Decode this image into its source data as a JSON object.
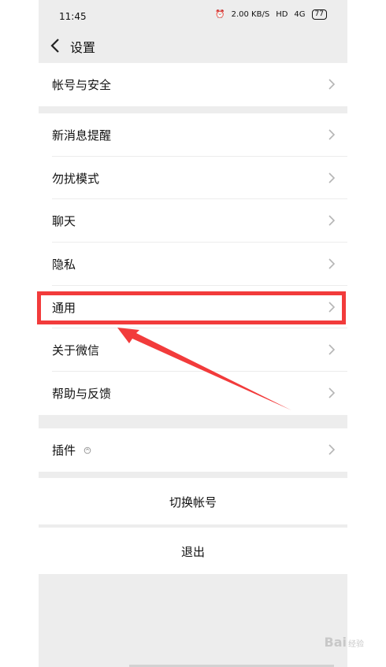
{
  "status_bar": {
    "time": "11:45",
    "speed": "2.00 KB/S",
    "network_1": "HD",
    "network_2": "4G",
    "battery": "77"
  },
  "header": {
    "title": "设置"
  },
  "groups": {
    "account": [
      {
        "label": "帐号与安全"
      }
    ],
    "main": [
      {
        "label": "新消息提醒"
      },
      {
        "label": "勿扰模式"
      },
      {
        "label": "聊天"
      },
      {
        "label": "隐私"
      },
      {
        "label": "通用"
      },
      {
        "label": "关于微信"
      },
      {
        "label": "帮助与反馈"
      }
    ],
    "plugins": [
      {
        "label": "插件"
      }
    ]
  },
  "actions": {
    "switch_account": "切换帐号",
    "logout": "退出"
  },
  "watermark": {
    "text": "Bai",
    "suffix": "经验"
  },
  "colors": {
    "background": "#ededed",
    "card": "#ffffff",
    "highlight": "#f23b3b",
    "chevron": "#b5b5b5"
  },
  "icons": {
    "back": "chevron-left-icon",
    "row": "chevron-right-icon",
    "plugin": "plugin-icon"
  }
}
